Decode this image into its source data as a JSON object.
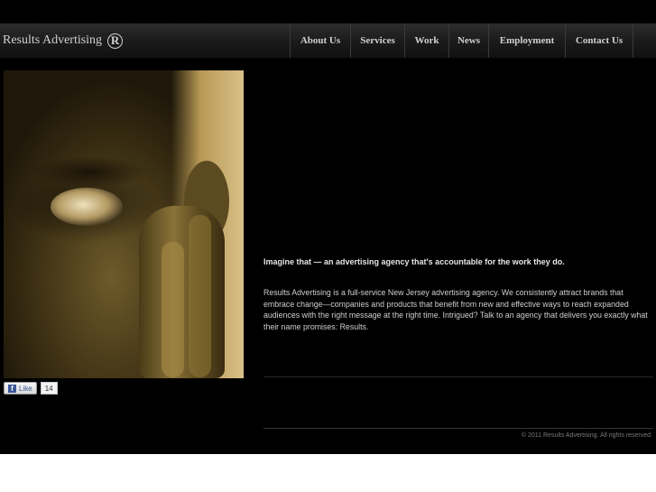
{
  "brand": {
    "name": "Results Advertising",
    "mark": "R"
  },
  "nav": {
    "items": [
      {
        "label": "About Us"
      },
      {
        "label": "Services"
      },
      {
        "label": "Work"
      },
      {
        "label": "News"
      },
      {
        "label": "Employment"
      },
      {
        "label": "Contact Us"
      }
    ]
  },
  "social": {
    "like_label": "Like",
    "fb_glyph": "f",
    "like_count": "14"
  },
  "content": {
    "tagline": "Imagine that — an advertising agency that's accountable for the work they do.",
    "intro": "Results Advertising is a full-service New Jersey advertising agency. We consistently attract brands that embrace change—companies and products that benefit from new and effective ways to reach expanded audiences with the right message at the right time. Intrigued? Talk to an agency that delivers you exactly what their name promises: Results."
  },
  "footer": {
    "copyright": "© 2011 Results Advertising. All rights reserved."
  },
  "colors": {
    "background": "#000000",
    "nav_text": "#d0d0d0",
    "body_text": "#cfcfcf",
    "facebook": "#3b5998"
  }
}
